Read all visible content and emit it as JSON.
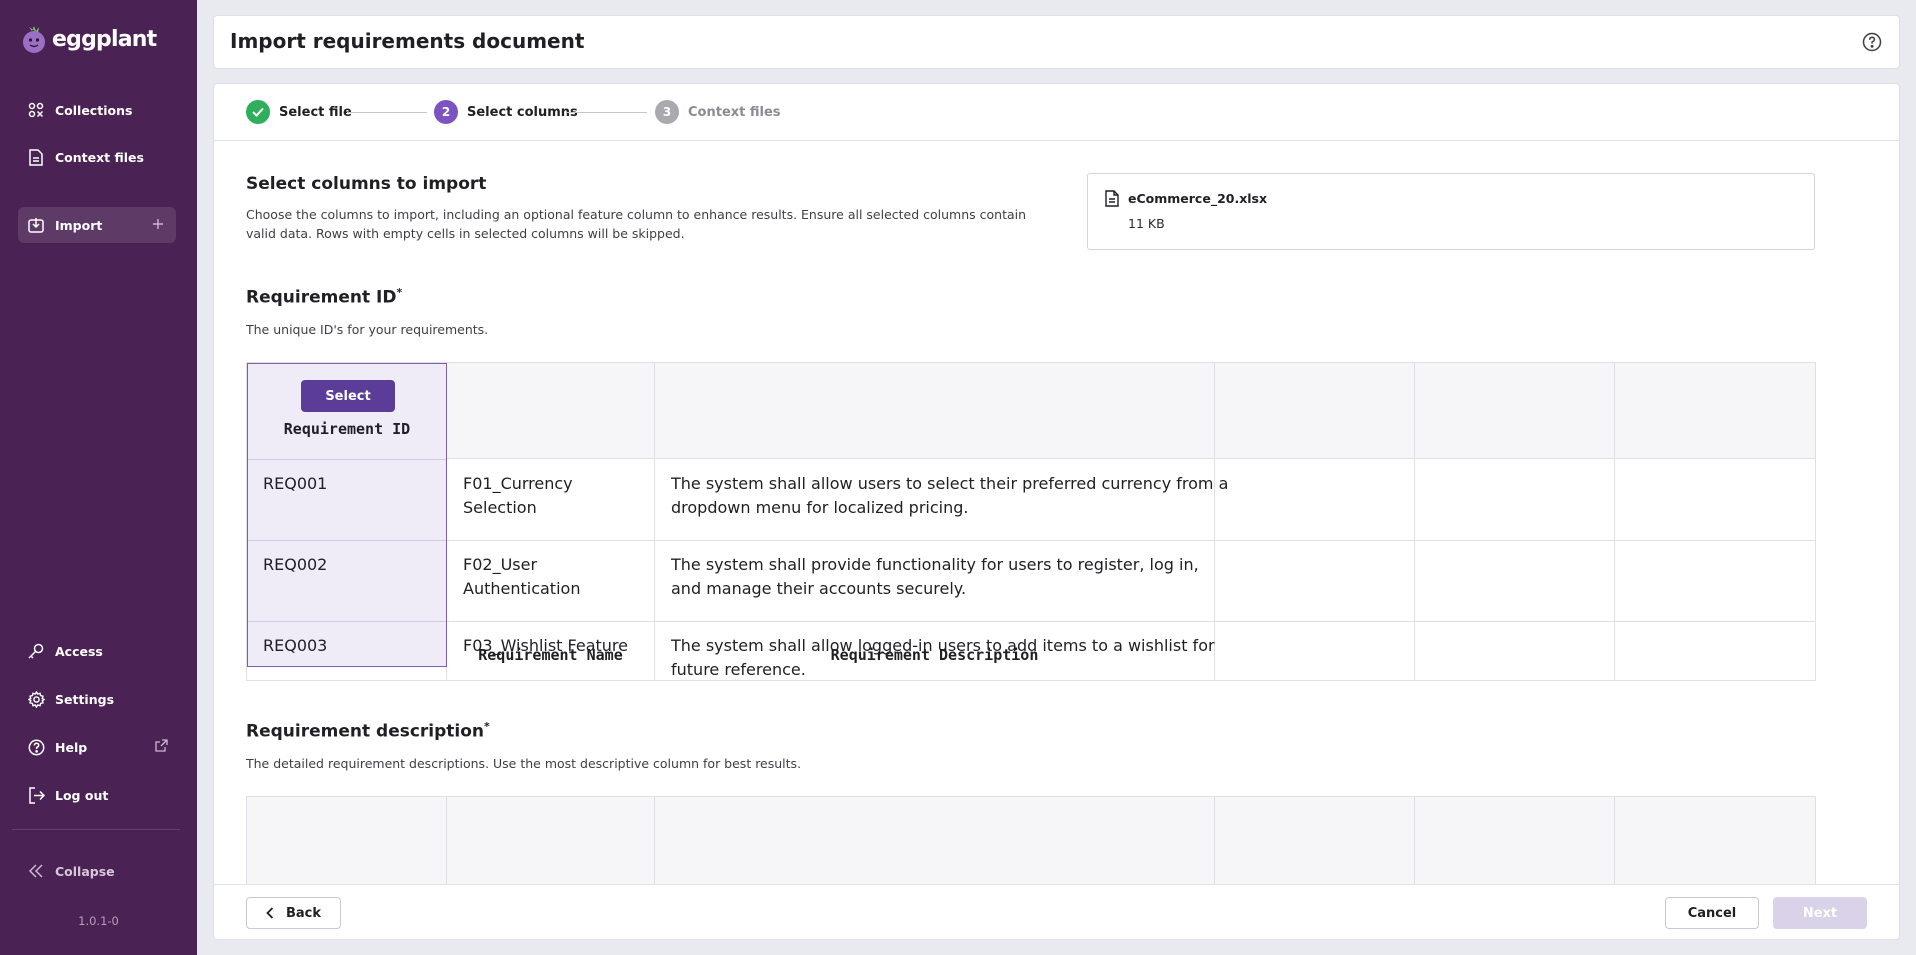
{
  "app": {
    "logo_text": "eggplant",
    "version": "1.0.1-0"
  },
  "sidebar": {
    "items": [
      {
        "label": "Collections",
        "icon": "collections-icon"
      },
      {
        "label": "Context files",
        "icon": "file-icon"
      },
      {
        "label": "Import",
        "icon": "import-icon",
        "active": true
      },
      {
        "label": "Access",
        "icon": "key-icon"
      },
      {
        "label": "Settings",
        "icon": "gear-icon"
      },
      {
        "label": "Help",
        "icon": "help-icon"
      },
      {
        "label": "Log out",
        "icon": "logout-icon"
      },
      {
        "label": "Collapse",
        "icon": "collapse-icon"
      }
    ]
  },
  "header": {
    "title": "Import requirements document"
  },
  "stepper": {
    "steps": [
      {
        "number": "1",
        "label": "Select file",
        "state": "done"
      },
      {
        "number": "2",
        "label": "Select columns",
        "state": "active"
      },
      {
        "number": "3",
        "label": "Context files",
        "state": "pending"
      }
    ]
  },
  "intro": {
    "title": "Select columns to import",
    "desc_line1": "Choose the columns to import, including an optional feature column to enhance results. Ensure all selected columns contain",
    "desc_line2": "valid data. Rows with empty cells in selected columns will be skipped."
  },
  "file": {
    "name": "eCommerce_20.xlsx",
    "size": "11 KB"
  },
  "req_id_section": {
    "title": "Requirement ID",
    "required_mark": "*",
    "desc": "The unique ID's for your requirements.",
    "select_label": "Select"
  },
  "table": {
    "headers": [
      "Requirement ID",
      "Requirement Name",
      "Requirement Description",
      "",
      "",
      ""
    ],
    "rows": [
      {
        "id": "REQ001",
        "name_line1": "F01_Currency",
        "name_line2": "Selection",
        "desc_line1": "The system shall allow users to select their preferred currency from a",
        "desc_line2": "dropdown menu for localized pricing."
      },
      {
        "id": "REQ002",
        "name_line1": "F02_User",
        "name_line2": "Authentication",
        "desc_line1": "The system shall provide functionality for users to register, log in,",
        "desc_line2": "and manage their accounts securely."
      },
      {
        "id": "REQ003",
        "name_line1": "F03_Wishlist Feature",
        "name_line2": "",
        "desc_line1": "The system shall allow logged-in users to add items to a wishlist for",
        "desc_line2": "future reference."
      }
    ]
  },
  "req_desc_section": {
    "title": "Requirement description",
    "required_mark": "*",
    "desc": "The detailed requirement descriptions. Use the most descriptive column for best results."
  },
  "footer": {
    "back_label": "Back",
    "cancel_label": "Cancel",
    "next_label": "Next"
  },
  "colors": {
    "sidebar_bg": "#4a2253",
    "accent": "#5b3d99",
    "success": "#2fae5c"
  }
}
